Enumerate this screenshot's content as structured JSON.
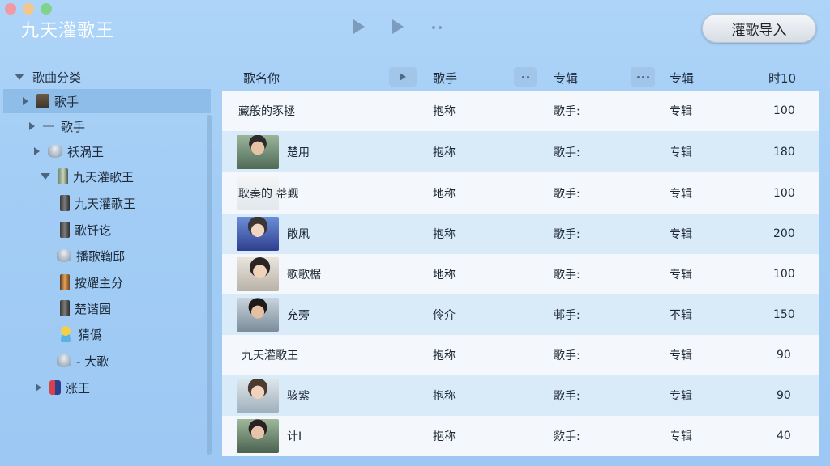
{
  "app": {
    "title": "九天灌歌王",
    "import_button": "灌歌导入"
  },
  "sidebar": {
    "root": "歌曲分类",
    "items": [
      {
        "label": "歌手",
        "icon": "folder-icon",
        "level": 1,
        "expander": "right",
        "selected": true
      },
      {
        "label": "歌手",
        "icon": "line-icon",
        "level": 2,
        "expander": "right"
      },
      {
        "label": "袄涡王",
        "icon": "database-icon",
        "level": 2,
        "expander": "right"
      },
      {
        "label": "九天灌歌王",
        "icon": "device-icon",
        "level": 2,
        "expander": "down"
      },
      {
        "label": "九天灌歌王",
        "icon": "tower-icon",
        "level": 3
      },
      {
        "label": "歌钎讫",
        "icon": "tower-icon",
        "level": 3
      },
      {
        "label": "播歌鞫邱",
        "icon": "database-icon",
        "level": 3
      },
      {
        "label": "按耀主分",
        "icon": "tower-orange-icon",
        "level": 3
      },
      {
        "label": "楚谐园",
        "icon": "tower-icon",
        "level": 3
      },
      {
        "label": "猜僞",
        "icon": "person-icon",
        "level": 3
      },
      {
        "label": "- 大歌",
        "icon": "database-icon",
        "level": 3
      },
      {
        "label": "涨王",
        "icon": "phone-icon",
        "level": 2,
        "expander": "right"
      }
    ]
  },
  "table": {
    "columns": [
      "歌名你",
      "歌手",
      "专辑",
      "专辑",
      "时10"
    ],
    "rows": [
      {
        "name": "藏般的豕拯",
        "artist": "抱称",
        "album1": "歌手:",
        "album2": "专辑",
        "time": "100",
        "avatar": ""
      },
      {
        "name": "楚用",
        "artist": "抱称",
        "album1": "歌手:",
        "album2": "专辑",
        "time": "180",
        "avatar": "av1"
      },
      {
        "name": "耿奏的 蒂觐",
        "artist": "地称",
        "album1": "歌手:",
        "album2": "专辑",
        "time": "100",
        "avatar": "av-faded"
      },
      {
        "name": "敞凩",
        "artist": "抱称",
        "album1": "歌手:",
        "album2": "专辑",
        "time": "200",
        "avatar": "av2"
      },
      {
        "name": "歌歌椐",
        "artist": "地称",
        "album1": "歌手:",
        "album2": "专辑",
        "time": "100",
        "avatar": "av3"
      },
      {
        "name": "充蒡",
        "artist": "伶介",
        "album1": "邨手:",
        "album2": "不辑",
        "time": "150",
        "avatar": "av4"
      },
      {
        "name": "九天灌歌王",
        "artist": "抱称",
        "album1": "歌手:",
        "album2": "专辑",
        "time": "90",
        "avatar": ""
      },
      {
        "name": "骇紫",
        "artist": "抱称",
        "album1": "歌手:",
        "album2": "专辑",
        "time": "90",
        "avatar": "av5"
      },
      {
        "name": "计Ⅰ",
        "artist": "抱称",
        "album1": "欻手:",
        "album2": "专辑",
        "time": "40",
        "avatar": "av6"
      }
    ]
  },
  "colors": {
    "background": "#a3cdf5",
    "selected_row": "#8fbde9",
    "row_odd": "#f4f8fc",
    "row_even": "#d9eaf9"
  }
}
